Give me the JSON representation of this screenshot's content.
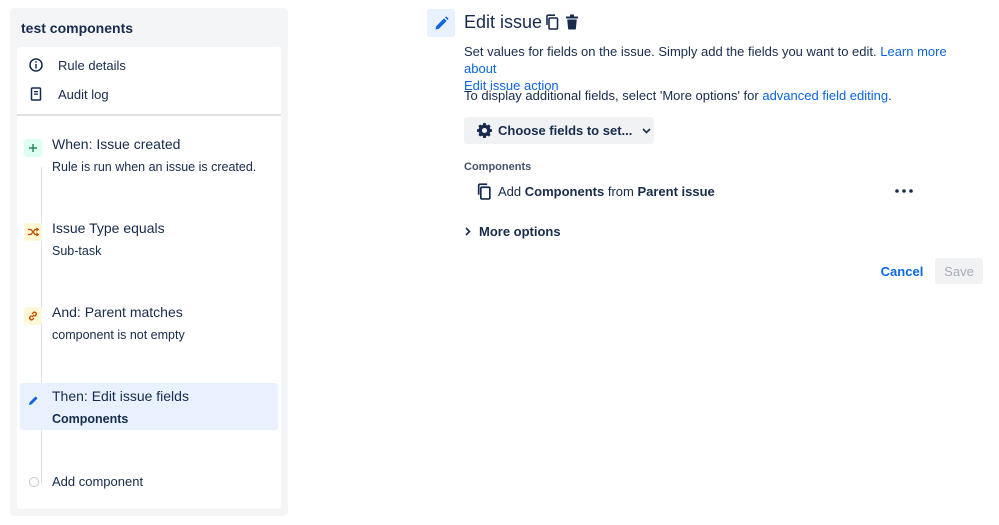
{
  "sidebar": {
    "title": "test components",
    "nav": [
      {
        "label": "Rule details",
        "icon": "info-icon"
      },
      {
        "label": "Audit log",
        "icon": "document-icon"
      }
    ],
    "steps": [
      {
        "title": "When: Issue created",
        "subtitle": "Rule is run when an issue is created.",
        "icon": "plus-icon",
        "color": "#1f845a",
        "bg": "#dcfff1"
      },
      {
        "title": "Issue Type equals",
        "subtitle": "Sub-task",
        "icon": "shuffle-icon",
        "color": "#c25100",
        "bg": "#fff7d6"
      },
      {
        "title": "And: Parent matches",
        "subtitle": "component is not empty",
        "icon": "link-icon",
        "color": "#c25100",
        "bg": "#fff7d6"
      },
      {
        "title": "Then: Edit issue fields",
        "subtitle": "Components",
        "icon": "pencil-icon",
        "color": "#0c66e4",
        "bg": "#e8f1fd"
      }
    ],
    "add_component": "Add component"
  },
  "main": {
    "title": "Edit issue",
    "description_text": "Set values for fields on the issue. Simply add the fields you want to edit. ",
    "description_link_1": "Learn more about",
    "description_link_2": "Edit issue action",
    "additional_text": "To display additional fields, select 'More options' for ",
    "additional_link": "advanced field editing",
    "additional_end": ".",
    "choose_fields_label": "Choose fields to set...",
    "section_label": "Components",
    "field": {
      "prefix": "Add ",
      "field_name": "Components",
      "middle": " from ",
      "source": "Parent issue"
    },
    "more_options": "More options",
    "cancel_label": "Cancel",
    "save_label": "Save"
  }
}
